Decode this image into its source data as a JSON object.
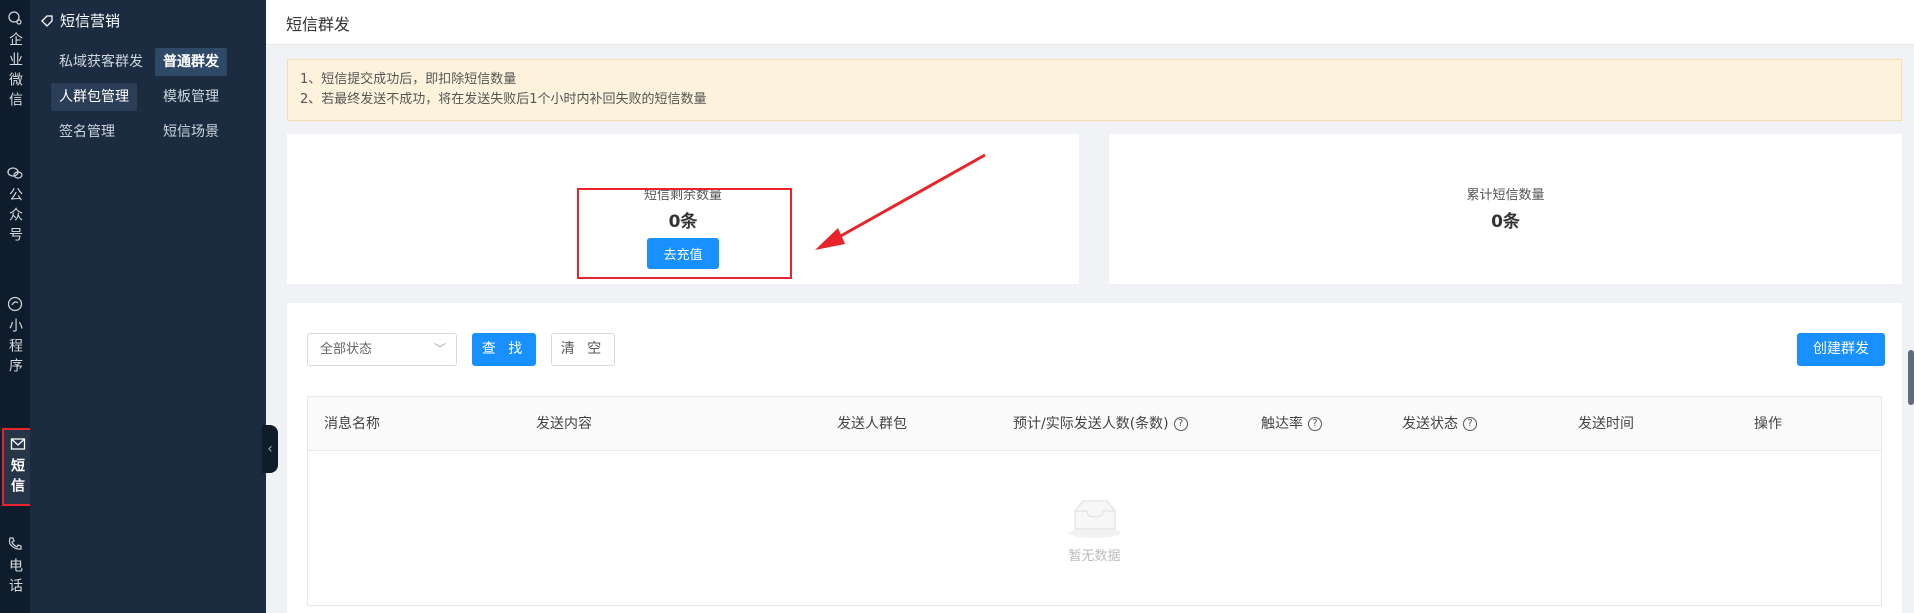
{
  "rail": {
    "items": [
      {
        "label": "企业微信",
        "icon": "wechat-work-icon"
      },
      {
        "label": "公众号",
        "icon": "official-account-icon"
      },
      {
        "label": "小程序",
        "icon": "mini-program-icon"
      },
      {
        "label": "短信",
        "icon": "mail-icon"
      },
      {
        "label": "电话",
        "icon": "phone-icon"
      }
    ]
  },
  "submenu": {
    "title": "短信营销",
    "items": [
      "私域获客群发",
      "普通群发",
      "人群包管理",
      "模板管理",
      "签名管理",
      "短信场景"
    ]
  },
  "page": {
    "title": "短信群发"
  },
  "notice": {
    "line1": "1、短信提交成功后，即扣除短信数量",
    "line2": "2、若最终发送不成功，将在发送失败后1个小时内补回失败的短信数量"
  },
  "stats": {
    "remaining_label": "短信剩余数量",
    "remaining_value": "0条",
    "recharge_label": "去充值",
    "total_label": "累计短信数量",
    "total_value": "0条"
  },
  "filters": {
    "status_select": "全部状态",
    "search_label": "查 找",
    "clear_label": "清 空",
    "create_label": "创建群发"
  },
  "table": {
    "columns": [
      "消息名称",
      "发送内容",
      "发送人群包",
      "预计/实际发送人数(条数)",
      "触达率",
      "发送状态",
      "发送时间",
      "操作"
    ],
    "empty_text": "暂无数据"
  },
  "colors": {
    "accent": "#1890ff",
    "highlight": "#e8242a",
    "sidebar": "#1b2c40"
  }
}
